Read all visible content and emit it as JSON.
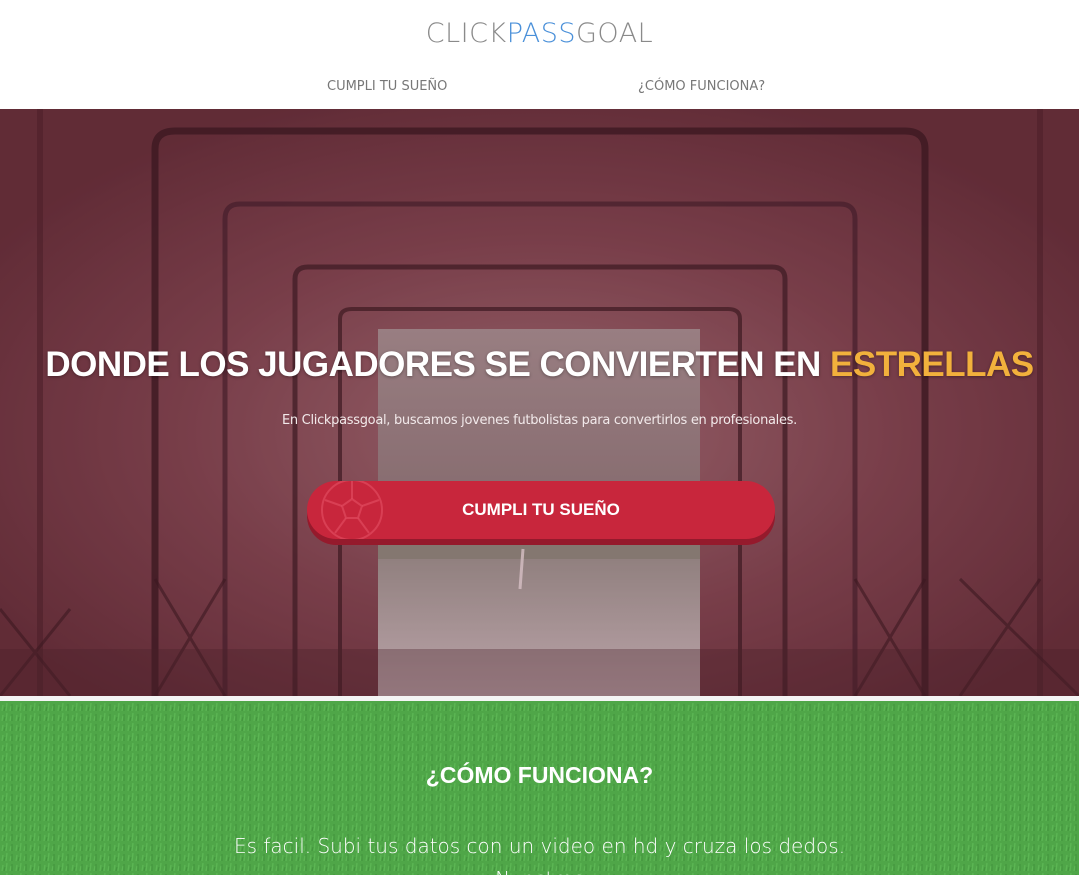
{
  "colors": {
    "accent": "#4a90d9",
    "highlight": "#f2b13c",
    "cta": "#c8263c",
    "grass": "#4fa648"
  },
  "header": {
    "logo": {
      "part1": "CLICK",
      "part2": "PASS",
      "part3": "GOAL"
    },
    "nav": [
      {
        "label": "CUMPLI TU SUEÑO"
      },
      {
        "label": "¿CÓMO FUNCIONA?"
      }
    ]
  },
  "hero": {
    "title_main": "DONDE LOS JUGADORES SE CONVIERTEN EN ",
    "title_highlight": "ESTRELLAS",
    "subtitle": "En Clickpassgoal, buscamos jovenes futbolistas para convertirlos en profesionales.",
    "cta_label": "CUMPLI TU SUEÑO",
    "cta_icon": "soccer-ball-icon"
  },
  "how": {
    "title": "¿CÓMO FUNCIONA?",
    "text": "Es facil. Subi tus datos con un video en hd y cruza los dedos. Nuestros"
  }
}
